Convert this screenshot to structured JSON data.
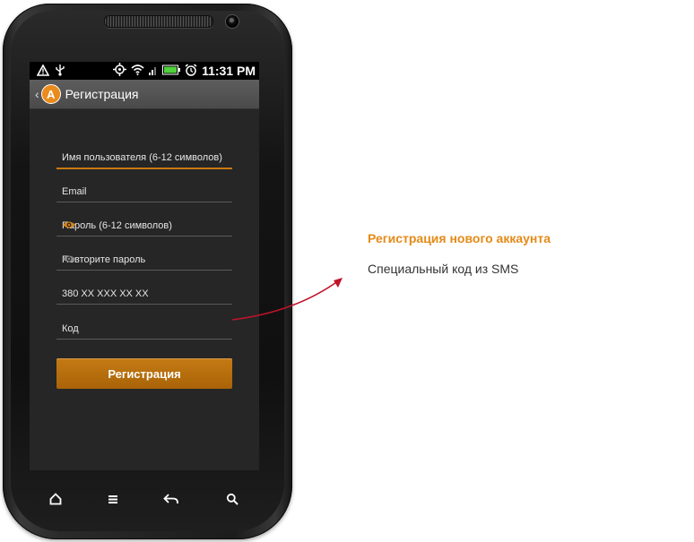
{
  "status_bar": {
    "time": "11:31 PM",
    "icons": [
      "warning-icon",
      "usb-icon",
      "gps-icon",
      "wifi-icon",
      "signal-icon",
      "battery-icon",
      "alarm-icon"
    ]
  },
  "app_bar": {
    "logo_letter": "A",
    "title": "Регистрация"
  },
  "form": {
    "username_placeholder": "Имя пользователя (6-12 символов)",
    "email_placeholder": "Email",
    "password_placeholder": "Пароль (6-12 символов)",
    "repeat_password_placeholder": "Повторите пароль",
    "phone_placeholder": "380 XX XXX XX XX",
    "code_placeholder": "Код",
    "submit_label": "Регистрация"
  },
  "nav_keys": [
    "home-icon",
    "menu-icon",
    "back-icon",
    "search-icon"
  ],
  "annotation": {
    "title": "Регистрация нового аккаунта",
    "subtitle": "Специальный код из SMS"
  },
  "colors": {
    "accent": "#e48a18",
    "button": "#b56d0b",
    "screen_bg": "#262626",
    "arrow": "#c0142a"
  }
}
